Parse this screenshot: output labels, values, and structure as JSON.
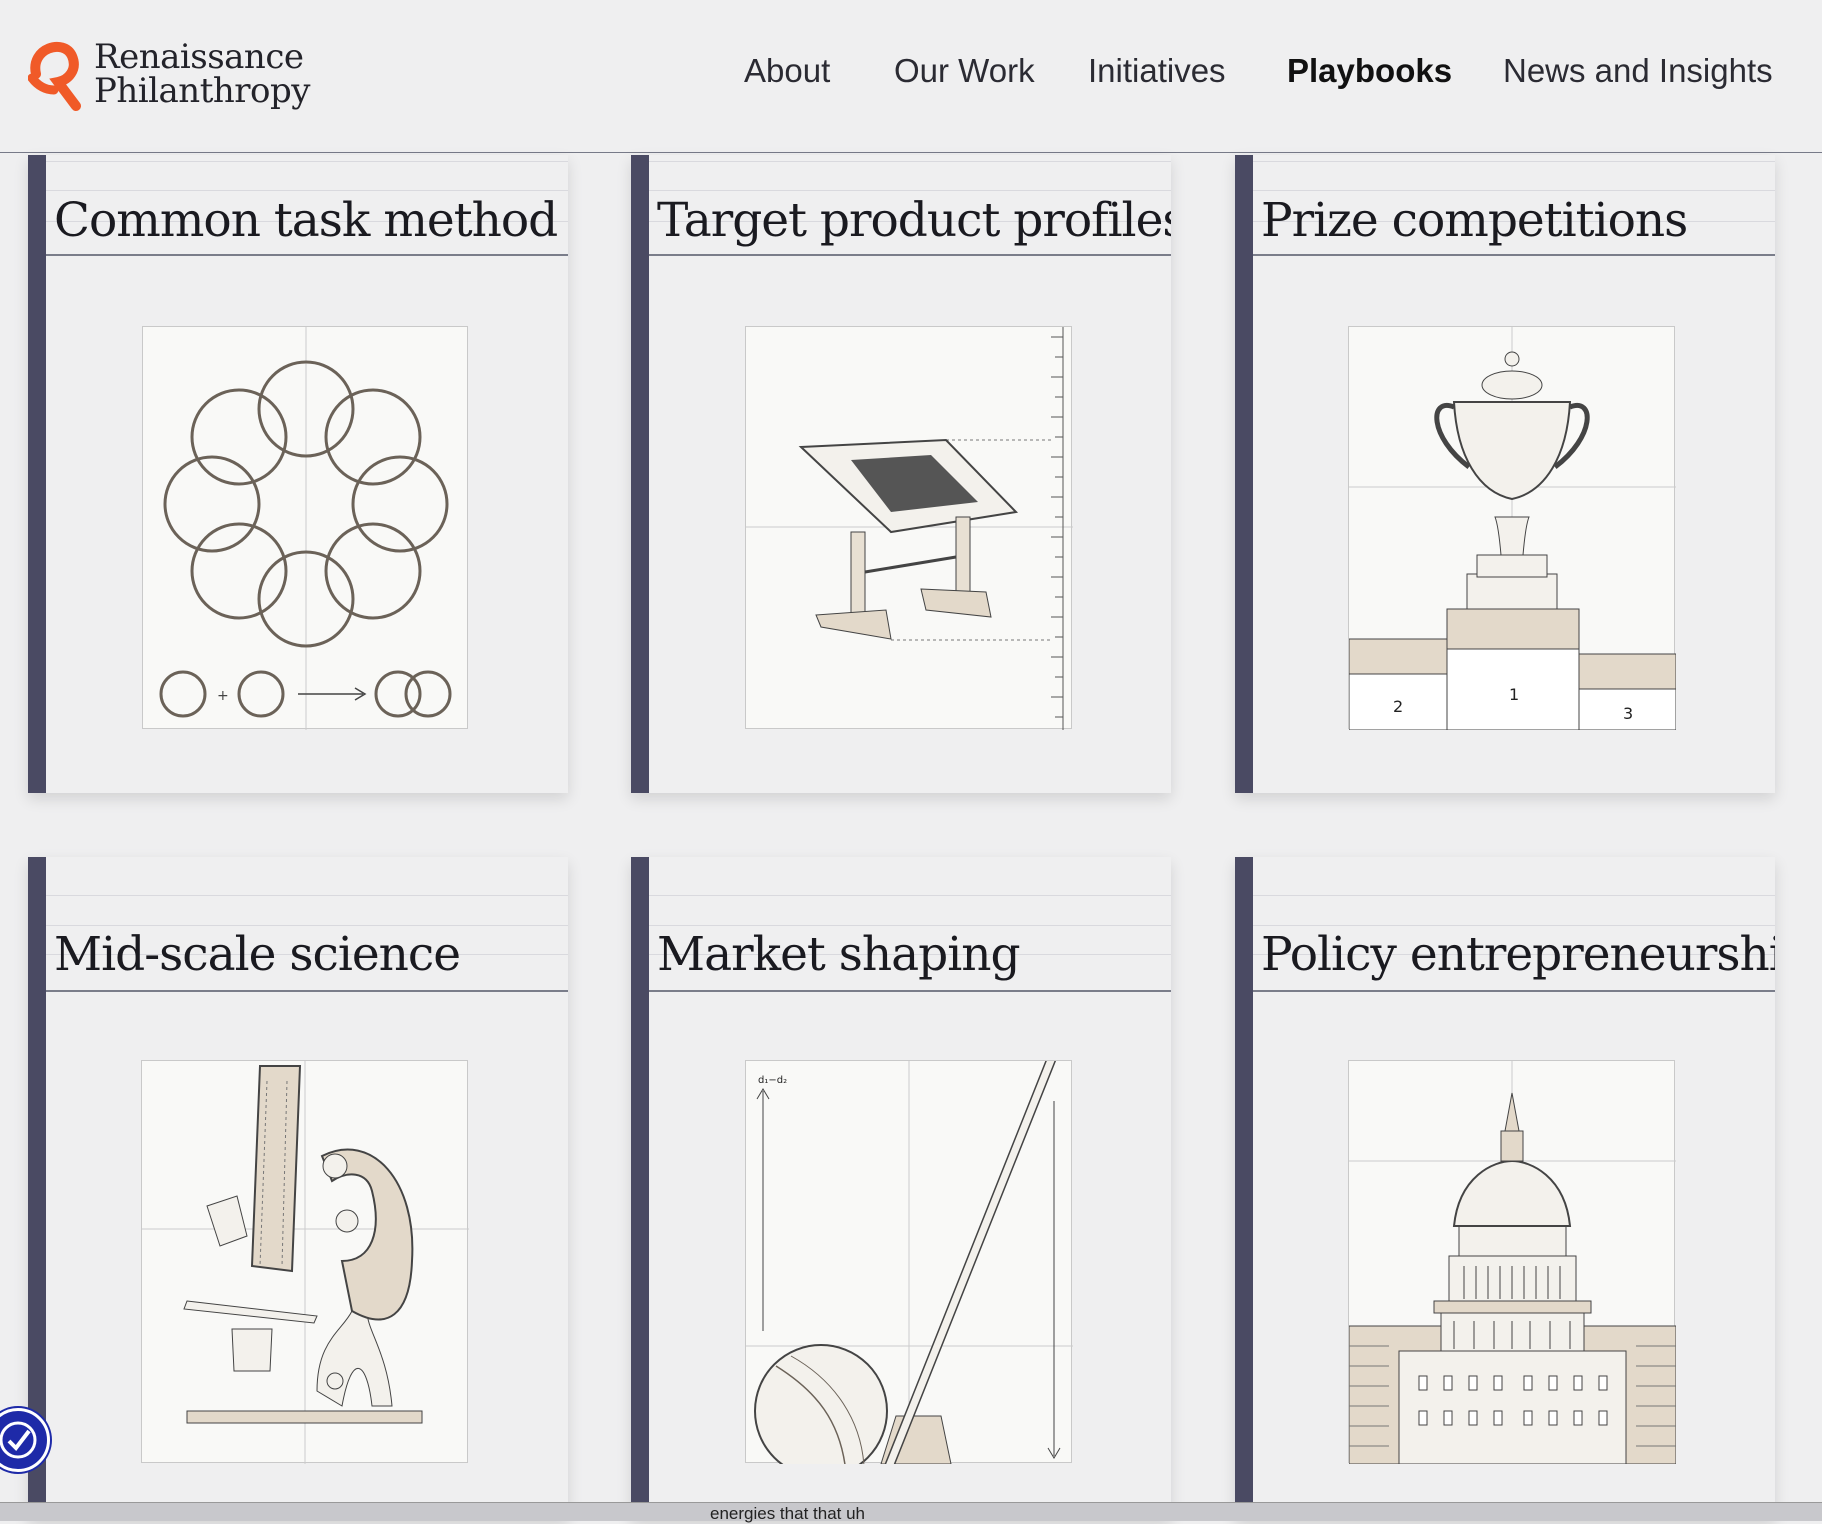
{
  "header": {
    "logo": {
      "line1": "Renaissance",
      "line2": "Philanthropy",
      "icon": "rp-logo-icon",
      "brand_color": "#f05a28"
    },
    "nav": [
      {
        "label": "About",
        "active": false
      },
      {
        "label": "Our Work",
        "active": false
      },
      {
        "label": "Initiatives",
        "active": false
      },
      {
        "label": "Playbooks",
        "active": true
      },
      {
        "label": "News and Insights",
        "active": false
      }
    ]
  },
  "cards": [
    {
      "title": "Common task method",
      "illustration": "rings-icon"
    },
    {
      "title": "Target product profiles",
      "illustration": "drafting-table-icon"
    },
    {
      "title": "Prize competitions",
      "illustration": "trophy-podium-icon",
      "podium_labels": [
        "2",
        "1",
        "3"
      ]
    },
    {
      "title": "Mid-scale science",
      "illustration": "microscope-icon"
    },
    {
      "title": "Market shaping",
      "illustration": "ball-lever-icon",
      "axis_label": "d₁−d₂"
    },
    {
      "title": "Policy entrepreneurship",
      "illustration": "capitol-icon"
    }
  ],
  "caption": "energies that that uh",
  "colors": {
    "spine": "#4a4a63",
    "accent": "#f05a28",
    "sketch_fill": "#e3d9ca",
    "accessibility": "#1e2aa8"
  }
}
